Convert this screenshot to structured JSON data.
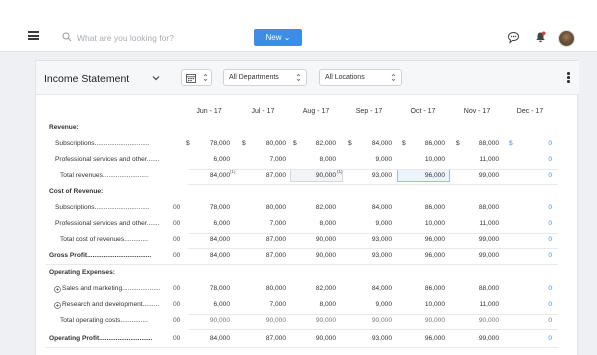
{
  "topbar": {
    "search_placeholder": "What are you looking for?",
    "new_button_label": "New",
    "new_button_chevron": "⌄"
  },
  "header": {
    "title": "Income Statement",
    "department_select": "All Departments",
    "location_select": "All Locations"
  },
  "columns": [
    "Jun - 17",
    "Jul - 17",
    "Aug - 17",
    "Sep - 17",
    "Oct - 17",
    "Nov - 17",
    "Dec - 17"
  ],
  "rows": [
    {
      "label": "Revenue:",
      "kind": "section",
      "values": []
    },
    {
      "label": "Subscriptions..............................",
      "kind": "item",
      "currency": "$",
      "values": [
        "78,000",
        "80,000",
        "82,000",
        "84,000",
        "86,000",
        "88,000",
        "0"
      ],
      "marker": ""
    },
    {
      "label": "Professional services and other.......",
      "kind": "item",
      "values": [
        "6,000",
        "7,000",
        "8,000",
        "9,000",
        "10,000",
        "11,000",
        "0"
      ],
      "marker": ""
    },
    {
      "label": "Total revenues.........................",
      "kind": "total",
      "values": [
        "84,000",
        "87,000",
        "90,000",
        "93,000",
        "96,000",
        "99,000",
        "0"
      ],
      "marker": ""
    },
    {
      "label": "Cost of Revenue:",
      "kind": "section",
      "values": []
    },
    {
      "label": "Subscriptions..............................",
      "kind": "item",
      "values": [
        "78,000",
        "80,000",
        "82,000",
        "84,000",
        "86,000",
        "88,000",
        "0"
      ],
      "marker": "00"
    },
    {
      "label": "Professional services and other.......",
      "kind": "item",
      "values": [
        "6,000",
        "7,000",
        "8,000",
        "9,000",
        "10,000",
        "11,000",
        "0"
      ],
      "marker": "00"
    },
    {
      "label": "Total cost of revenues.............",
      "kind": "total",
      "values": [
        "84,000",
        "87,000",
        "90,000",
        "93,000",
        "96,000",
        "99,000",
        "0"
      ],
      "marker": "00"
    },
    {
      "label": "Gross Profit...................................",
      "kind": "section",
      "values": [
        "84,000",
        "87,000",
        "90,000",
        "93,000",
        "96,000",
        "99,000",
        "0"
      ],
      "marker": "00"
    },
    {
      "label": "Operating Expenses:",
      "kind": "section",
      "values": []
    },
    {
      "label": "Sales and marketing.....................",
      "kind": "expand",
      "values": [
        "78,000",
        "80,000",
        "82,000",
        "84,000",
        "86,000",
        "88,000",
        "0"
      ],
      "marker": "00"
    },
    {
      "label": "Research and development.........",
      "kind": "expand",
      "values": [
        "6,000",
        "7,000",
        "8,000",
        "9,000",
        "10,000",
        "11,000",
        "0"
      ],
      "marker": "00"
    },
    {
      "label": "Total operating costs...............",
      "kind": "total",
      "values": [
        "90,000",
        "90,000",
        "90,000",
        "90,000",
        "90,000",
        "90,000",
        "0"
      ],
      "marker": "00"
    },
    {
      "label": "Operating Profit.............................",
      "kind": "section",
      "values": [
        "84,000",
        "87,000",
        "90,000",
        "93,000",
        "96,000",
        "99,000",
        "0"
      ],
      "marker": "00"
    }
  ],
  "cell_markers": {
    "jun_total": "(1)",
    "aug_total": "(1)"
  },
  "colors": {
    "accent": "#3d8de6"
  }
}
